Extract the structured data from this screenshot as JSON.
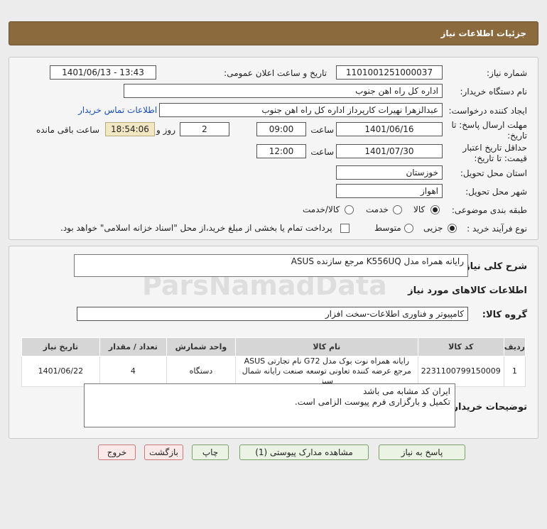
{
  "header": {
    "title": "جزئیات اطلاعات نیاز"
  },
  "form": {
    "need_number_label": "شماره نیاز:",
    "need_number": "1101001251000037",
    "announce_label": "تاریخ و ساعت اعلان عمومی:",
    "announce_value": "1401/06/13 - 13:43",
    "buyer_org_label": "نام دستگاه خریدار:",
    "buyer_org": "اداره کل راه اهن جنوب",
    "creator_label": "ایجاد کننده درخواست:",
    "creator": "عبدالزهرا نهیرات کارپرداز اداره کل راه اهن جنوب",
    "contact_link": "اطلاعات تماس خریدار",
    "reply_deadline_label_1": "مهلت ارسال پاسخ: تا",
    "reply_deadline_label_2": "تاریخ:",
    "reply_date": "1401/06/16",
    "time_label": "ساعت",
    "reply_time": "09:00",
    "days_value": "2",
    "days_label": "روز و",
    "remaining_time": "18:54:06",
    "remaining_label": "ساعت باقی مانده",
    "validity_label_1": "حداقل تاریخ اعتبار",
    "validity_label_2": "قیمت: تا تاریخ:",
    "validity_date": "1401/07/30",
    "validity_time": "12:00",
    "province_label": "استان محل تحویل:",
    "province": "خوزستان",
    "city_label": "شهر محل تحویل:",
    "city": "اهواز",
    "category_label": "طبقه بندی موضوعی:",
    "category_options": [
      "کالا",
      "خدمت",
      "کالا/خدمت"
    ],
    "process_label": "نوع فرآیند خرید :",
    "process_options": [
      "جزیی",
      "متوسط"
    ],
    "payment_note": "پرداخت تمام یا بخشی از مبلغ خرید،از محل \"اسناد خزانه اسلامی\" خواهد بود."
  },
  "details": {
    "summary_label": "شرح کلی نیاز:",
    "summary": "رایانه همراه مدل K556UQ مرجع سازنده ASUS",
    "goods_info_title": "اطلاعات کالاهای مورد نیاز",
    "group_label": "گروه کالا:",
    "group_value": "کامپیوتر و فناوری اطلاعات-سخت افزار",
    "table": {
      "headers": [
        "ردیف",
        "کد کالا",
        "نام کالا",
        "واحد شمارش",
        "تعداد / مقدار",
        "تاریخ نیاز"
      ],
      "rows": [
        {
          "row": "1",
          "code": "2231100799150009",
          "name": "رایانه همراه نوت بوک مدل G72 نام تجارتی ASUS مرجع عرضه کننده تعاونی توسعه صنعت رایانه شمال سبز",
          "unit": "دستگاه",
          "qty": "4",
          "date": "1401/06/22"
        }
      ]
    },
    "buyer_notes_label": "توضیحات خریدار:",
    "buyer_notes_line1": "ایران کد مشابه می باشد",
    "buyer_notes_line2": "تکمیل و بارگزاری فرم پیوست الزامی است."
  },
  "buttons": {
    "reply": "پاسخ به نیاز",
    "view_docs": "مشاهده مدارک پیوستی (1)",
    "print": "چاپ",
    "back": "بازگشت",
    "exit": "خروج"
  },
  "colors": {
    "header": "#8b6b3d",
    "link": "#1a4fb5",
    "remaining_bg": "#f1e7c3"
  }
}
